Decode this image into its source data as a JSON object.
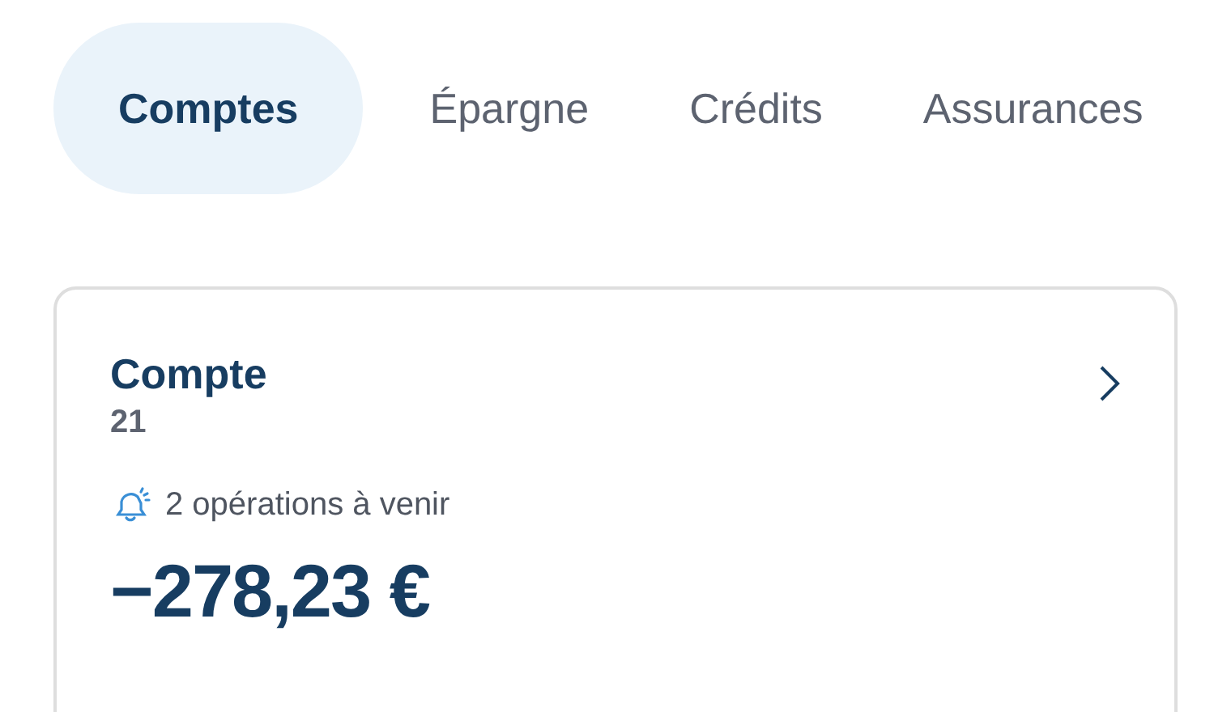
{
  "tabs": [
    {
      "label": "Comptes",
      "selected": true
    },
    {
      "label": "Épargne",
      "selected": false
    },
    {
      "label": "Crédits",
      "selected": false
    },
    {
      "label": "Assurances",
      "selected": false
    }
  ],
  "account": {
    "title": "Compte",
    "number": "21",
    "upcoming": "2 opérations à venir",
    "balance": "−278,23 €"
  }
}
